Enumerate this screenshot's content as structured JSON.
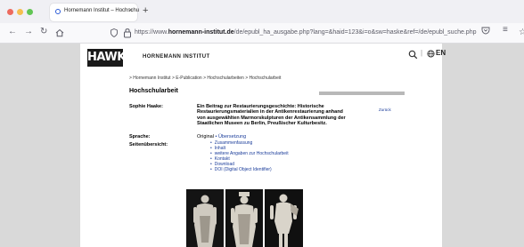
{
  "browser": {
    "tab_title": "Hornemann Institut – Hochschu",
    "tab_close": "×",
    "new_tab": "+",
    "url_prefix": "https://www.",
    "url_domain": "hornemann-institut.de",
    "url_path": "/de/epubl_ha_ausgabe.php?lang=&haid=123&i=o&sw=haske&ref=/de/epubl_suche.php",
    "icons": [
      "close-dot",
      "minimize-dot",
      "maximize-dot",
      "back-icon",
      "forward-icon",
      "reload-icon",
      "home-icon",
      "shield-icon",
      "lock-icon",
      "star-icon",
      "pocket-icon",
      "menu-icon"
    ],
    "colors": {
      "close": "#ed6a5e",
      "minimize": "#f5bf4f",
      "maximize": "#61c554"
    }
  },
  "header": {
    "logo": "HAWK",
    "institute": "HORNEMANN INSTITUT",
    "separator": "|",
    "language": "EN"
  },
  "breadcrumb": "> Hornemann Institut > E-Publication > Hochschularbeiten > Hochschularbeit",
  "main": {
    "heading": "Hochschularbeit",
    "author_label": "Sophie Haake:",
    "work_title": "Ein Beitrag zur Restaurierungsgeschichte: Historische Restaurierungsmaterialien in der Antikenrestaurierung anhand von ausgewählten Marmorskulpturen der Antikensammlung der Staatlichen Museen zu Berlin, Preußischer Kulturbesitz.",
    "back_link": "Zurück",
    "language_label": "Sprache:",
    "language_original": "Original",
    "language_sep": "•",
    "language_translation": "Übersetzung",
    "overview_label": "Seitenübersicht:",
    "overview_items": [
      "Zusammenfassung",
      "Inhalt",
      "weitere Angaben zur Hochschularbeit",
      "Kontakt",
      "Download",
      "DOI (Digital Object Identifier)"
    ]
  }
}
